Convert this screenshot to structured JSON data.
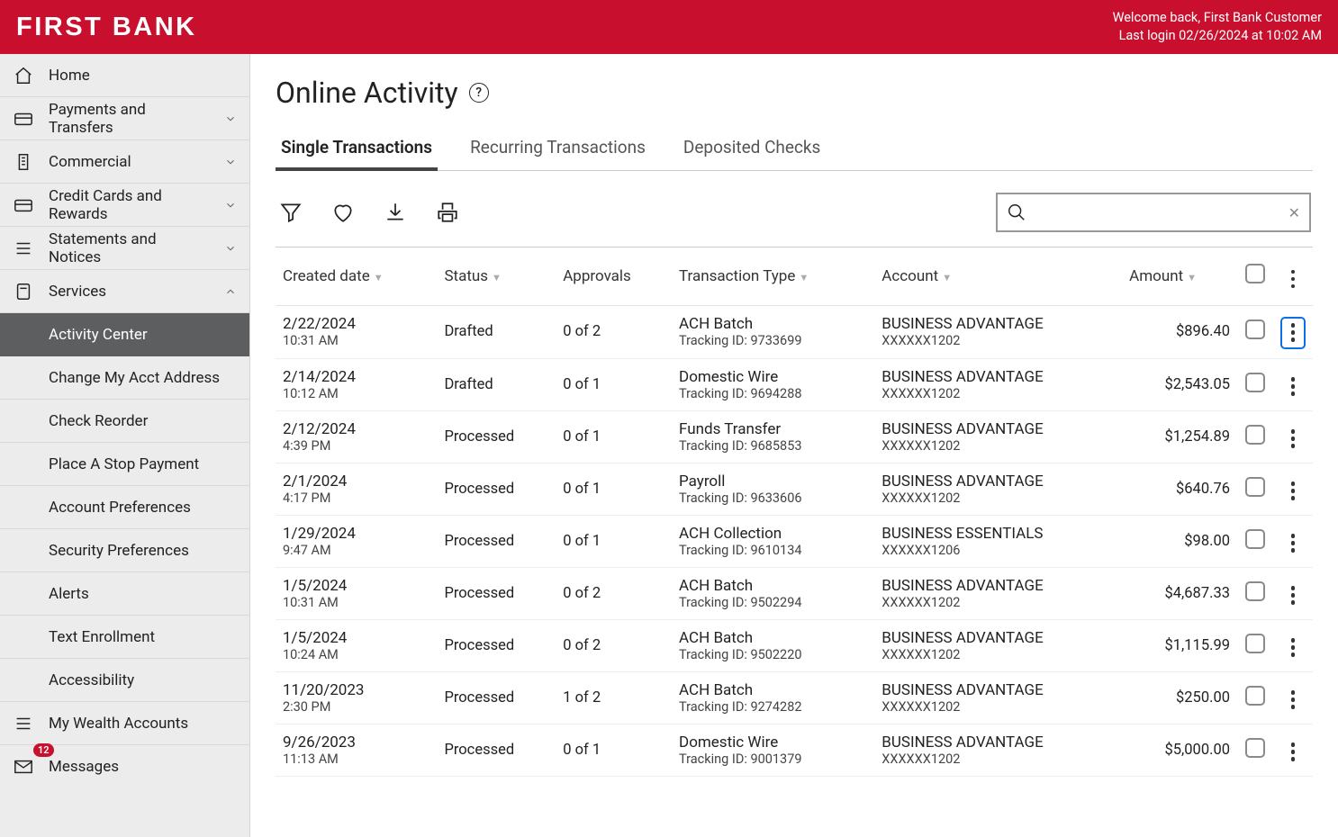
{
  "header": {
    "brand": "FIRST BANK",
    "welcome": "Welcome back, First Bank Customer",
    "last_login": "Last login 02/26/2024 at 10:02 AM"
  },
  "sidebar": {
    "home": "Home",
    "payments": "Payments and Transfers",
    "commercial": "Commercial",
    "credit": "Credit Cards and Rewards",
    "statements": "Statements and Notices",
    "services": "Services",
    "services_children": {
      "activity_center": "Activity Center",
      "change_addr": "Change My Acct Address",
      "check_reorder": "Check Reorder",
      "stop_payment": "Place A Stop Payment",
      "acct_prefs": "Account Preferences",
      "security_prefs": "Security Preferences",
      "alerts": "Alerts",
      "text_enroll": "Text Enrollment",
      "accessibility": "Accessibility"
    },
    "wealth": "My Wealth Accounts",
    "messages": "Messages",
    "messages_badge": "12"
  },
  "page": {
    "title": "Online Activity"
  },
  "tabs": {
    "single": "Single Transactions",
    "recurring": "Recurring Transactions",
    "deposited": "Deposited Checks"
  },
  "columns": {
    "created": "Created date",
    "status": "Status",
    "approvals": "Approvals",
    "type": "Transaction Type",
    "account": "Account",
    "amount": "Amount"
  },
  "tracking_prefix": "Tracking ID:",
  "rows": [
    {
      "date": "2/22/2024",
      "time": "10:31 AM",
      "status": "Drafted",
      "approvals": "0 of 2",
      "type": "ACH Batch",
      "tracking": "9733699",
      "account_name": "BUSINESS ADVANTAGE",
      "account_mask": "XXXXXX1202",
      "amount": "$896.40",
      "highlight": true
    },
    {
      "date": "2/14/2024",
      "time": "10:12 AM",
      "status": "Drafted",
      "approvals": "0 of 1",
      "type": "Domestic Wire",
      "tracking": "9694288",
      "account_name": "BUSINESS ADVANTAGE",
      "account_mask": "XXXXXX1202",
      "amount": "$2,543.05",
      "highlight": false
    },
    {
      "date": "2/12/2024",
      "time": "4:39 PM",
      "status": "Processed",
      "approvals": "0 of 1",
      "type": "Funds Transfer",
      "tracking": "9685853",
      "account_name": "BUSINESS ADVANTAGE",
      "account_mask": "XXXXXX1202",
      "amount": "$1,254.89",
      "highlight": false
    },
    {
      "date": "2/1/2024",
      "time": "4:17 PM",
      "status": "Processed",
      "approvals": "0 of 1",
      "type": "Payroll",
      "tracking": "9633606",
      "account_name": "BUSINESS ADVANTAGE",
      "account_mask": "XXXXXX1202",
      "amount": "$640.76",
      "highlight": false
    },
    {
      "date": "1/29/2024",
      "time": "9:47 AM",
      "status": "Processed",
      "approvals": "0 of 1",
      "type": "ACH Collection",
      "tracking": "9610134",
      "account_name": "BUSINESS ESSENTIALS",
      "account_mask": "XXXXXX1206",
      "amount": "$98.00",
      "highlight": false
    },
    {
      "date": "1/5/2024",
      "time": "10:31 AM",
      "status": "Processed",
      "approvals": "0 of 2",
      "type": "ACH Batch",
      "tracking": "9502294",
      "account_name": "BUSINESS ADVANTAGE",
      "account_mask": "XXXXXX1202",
      "amount": "$4,687.33",
      "highlight": false
    },
    {
      "date": "1/5/2024",
      "time": "10:24 AM",
      "status": "Processed",
      "approvals": "0 of 2",
      "type": "ACH Batch",
      "tracking": "9502220",
      "account_name": "BUSINESS ADVANTAGE",
      "account_mask": "XXXXXX1202",
      "amount": "$1,115.99",
      "highlight": false
    },
    {
      "date": "11/20/2023",
      "time": "2:30 PM",
      "status": "Processed",
      "approvals": "1 of 2",
      "type": "ACH Batch",
      "tracking": "9274282",
      "account_name": "BUSINESS ADVANTAGE",
      "account_mask": "XXXXXX1202",
      "amount": "$250.00",
      "highlight": false
    },
    {
      "date": "9/26/2023",
      "time": "11:13 AM",
      "status": "Processed",
      "approvals": "0 of 1",
      "type": "Domestic Wire",
      "tracking": "9001379",
      "account_name": "BUSINESS ADVANTAGE",
      "account_mask": "XXXXXX1202",
      "amount": "$5,000.00",
      "highlight": false
    }
  ]
}
